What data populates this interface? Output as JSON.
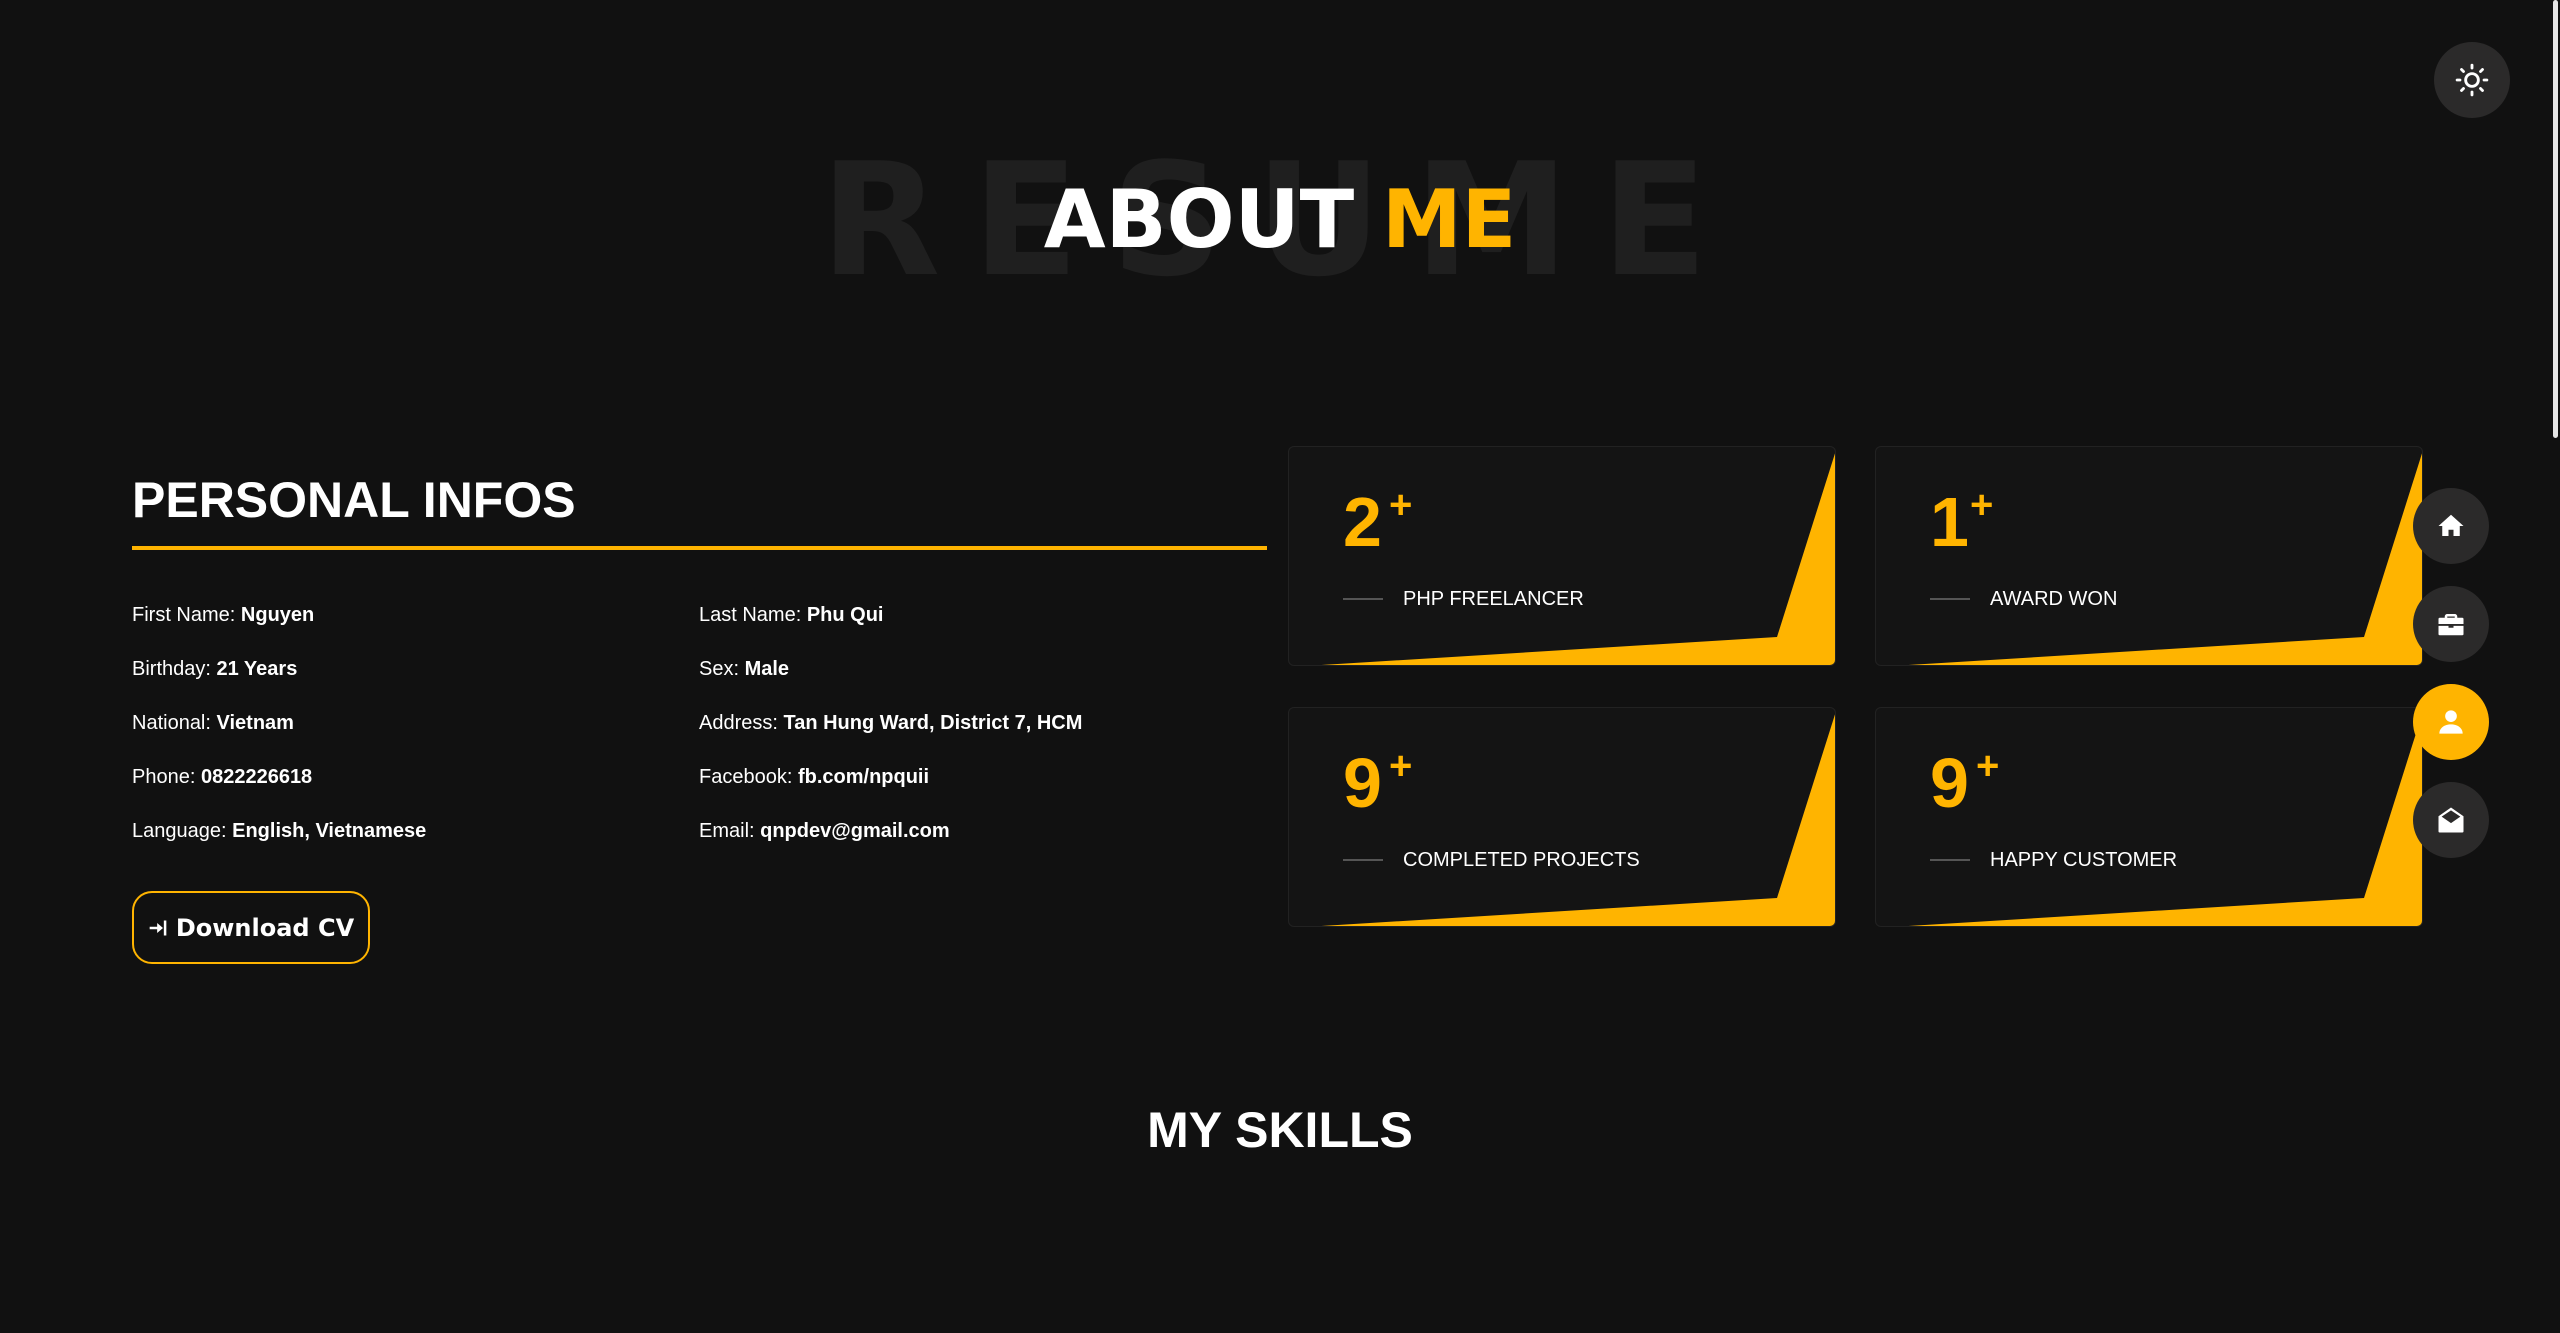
{
  "theme_toggle": {
    "icon": "sun-icon"
  },
  "title": {
    "background_word": "RESUME",
    "main": "ABOUT",
    "accent": "ME"
  },
  "personal": {
    "heading": "PERSONAL INFOS",
    "left": [
      {
        "label": "First Name: ",
        "value": "Nguyen"
      },
      {
        "label": "Birthday: ",
        "value": "21 Years"
      },
      {
        "label": "National: ",
        "value": "Vietnam"
      },
      {
        "label": "Phone: ",
        "value": "0822226618"
      },
      {
        "label": "Language: ",
        "value": "English, Vietnamese"
      }
    ],
    "right": [
      {
        "label": "Last Name: ",
        "value": "Phu Qui"
      },
      {
        "label": "Sex: ",
        "value": "Male"
      },
      {
        "label": "Address: ",
        "value": "Tan Hung Ward, District 7, HCM"
      },
      {
        "label": "Facebook: ",
        "value": "fb.com/npquii"
      },
      {
        "label": "Email: ",
        "value": "qnpdev@gmail.com"
      }
    ],
    "download_label": "Download CV"
  },
  "stats": [
    {
      "number": "2",
      "plus": "+",
      "label": "PHP FREELANCER"
    },
    {
      "number": "1",
      "plus": "+",
      "label": "AWARD WON"
    },
    {
      "number": "9",
      "plus": "+",
      "label": "COMPLETED PROJECTS"
    },
    {
      "number": "9",
      "plus": "+",
      "label": "HAPPY CUSTOMER"
    }
  ],
  "nav": [
    {
      "icon": "home-icon",
      "active": false
    },
    {
      "icon": "briefcase-icon",
      "active": false
    },
    {
      "icon": "user-icon",
      "active": true
    },
    {
      "icon": "envelope-open-icon",
      "active": false
    }
  ],
  "skills": {
    "heading": "MY SKILLS"
  },
  "colors": {
    "accent": "#ffb400",
    "background": "#111111",
    "button": "#2b2a2a"
  }
}
